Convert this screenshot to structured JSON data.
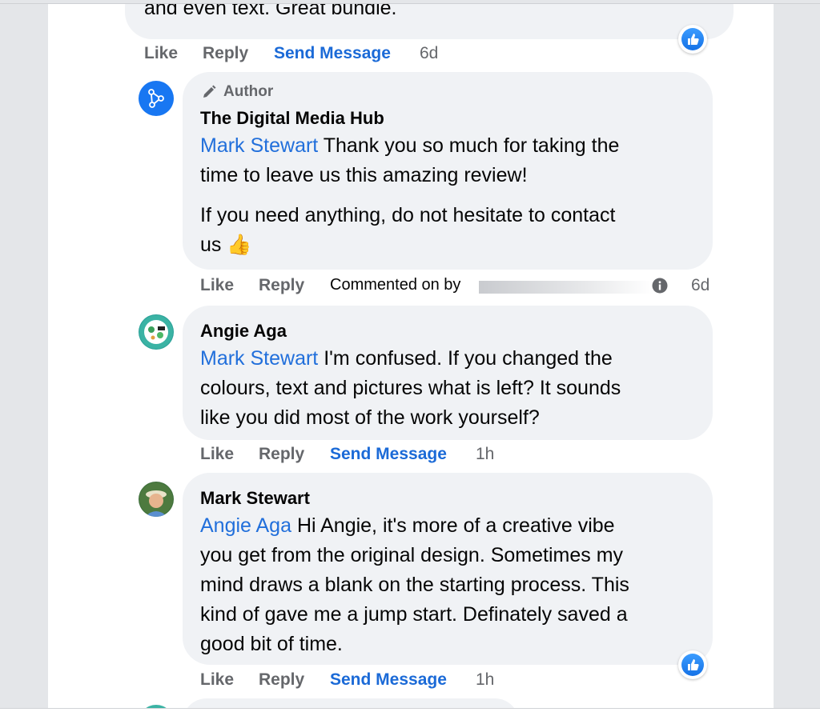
{
  "top_comment": {
    "text_partial": "and even text. Great bundle.",
    "actions": {
      "like": "Like",
      "reply": "Reply",
      "send_message": "Send Message",
      "time": "6d"
    }
  },
  "comments": [
    {
      "author_badge": "Author",
      "name": "The Digital Media Hub",
      "mention": "Mark Stewart",
      "line1_rest": " Thank you so much for taking the",
      "line2": "time to leave us this amazing review!",
      "line3": "If you need anything, do not hesitate to contact",
      "line4": "us",
      "emoji": "👍",
      "actions": {
        "like": "Like",
        "reply": "Reply",
        "commented_on_by": "Commented on by",
        "time": "6d"
      }
    },
    {
      "name": "Angie Aga",
      "mention": "Mark Stewart",
      "line1_rest": " I'm confused. If you changed the",
      "line2": "colours, text and pictures what is left? It sounds",
      "line3": "like you did most of the work yourself?",
      "actions": {
        "like": "Like",
        "reply": "Reply",
        "send_message": "Send Message",
        "time": "1h"
      }
    },
    {
      "name": "Mark Stewart",
      "mention": "Angie Aga",
      "line1_rest": " Hi Angie, it's more of a creative vibe",
      "line2": "you get from the original design. Sometimes my",
      "line3": "mind draws a blank on the starting process. This",
      "line4": "kind of gave me a jump start. Definately saved a",
      "line5": "good bit of time.",
      "actions": {
        "like": "Like",
        "reply": "Reply",
        "send_message": "Send Message",
        "time": "1h"
      }
    }
  ],
  "colors": {
    "page_background": "#e4e6e9",
    "bubble": "#f0f2f5",
    "mention": "#216fdb",
    "send_message": "#1b6ad7",
    "action_grey": "#65676b",
    "like_badge": "#1672e6"
  },
  "icons": [
    "like-thumb-icon",
    "pencil-icon",
    "info-icon",
    "avatar-network-icon"
  ]
}
